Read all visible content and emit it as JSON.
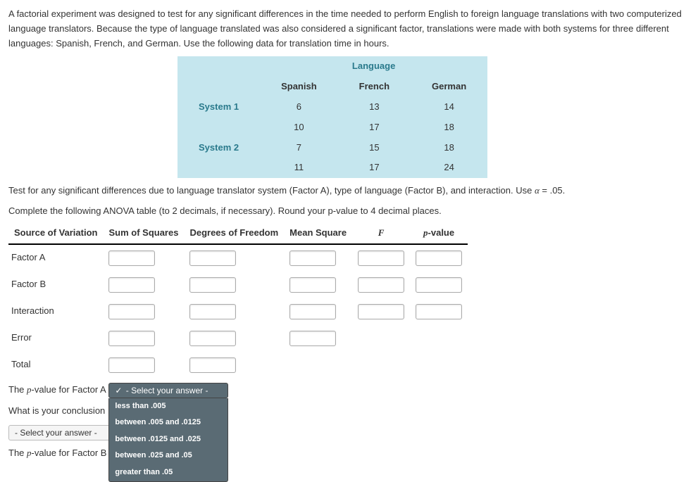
{
  "intro": "A factorial experiment was designed to test for any significant differences in the time needed to perform English to foreign language translations with two computerized language translators. Because the type of language translated was also considered a significant factor, translations were made with both systems for three different languages: Spanish, French, and German. Use the following data for translation time in hours.",
  "dataTable": {
    "superHeader": "Language",
    "cols": [
      "Spanish",
      "French",
      "German"
    ],
    "rows": [
      {
        "label": "System 1",
        "vals": [
          "6",
          "13",
          "14"
        ]
      },
      {
        "label": "",
        "vals": [
          "10",
          "17",
          "18"
        ]
      },
      {
        "label": "System 2",
        "vals": [
          "7",
          "15",
          "18"
        ]
      },
      {
        "label": "",
        "vals": [
          "11",
          "17",
          "24"
        ]
      }
    ]
  },
  "afterTable1_pre": "Test for any significant differences due to language translator system (Factor A), type of language (Factor B), and interaction. Use ",
  "afterTable1_alpha": "α",
  "afterTable1_eq": " = .05.",
  "afterTable2": "Complete the following ANOVA table (to 2 decimals, if necessary). Round your p-value to 4 decimal places.",
  "anova": {
    "headers": {
      "src": "Source of Variation",
      "ss": "Sum of Squares",
      "df": "Degrees of Freedom",
      "ms": "Mean Square",
      "f": "F",
      "p": "p-value"
    },
    "rows": [
      "Factor A",
      "Factor B",
      "Interaction",
      "Error",
      "Total"
    ]
  },
  "q": {
    "pvalA_label": "The p-value for Factor A",
    "conclusion_label": "What is your conclusion",
    "pvalB_label": "The p-value for Factor B",
    "placeholder_checked": "- Select your answer -",
    "placeholder_plain": "- Select your answer -",
    "options": [
      "less than .005",
      "between .005 and .0125",
      "between .0125 and .025",
      "between .025 and .05",
      "greater than .05"
    ]
  }
}
